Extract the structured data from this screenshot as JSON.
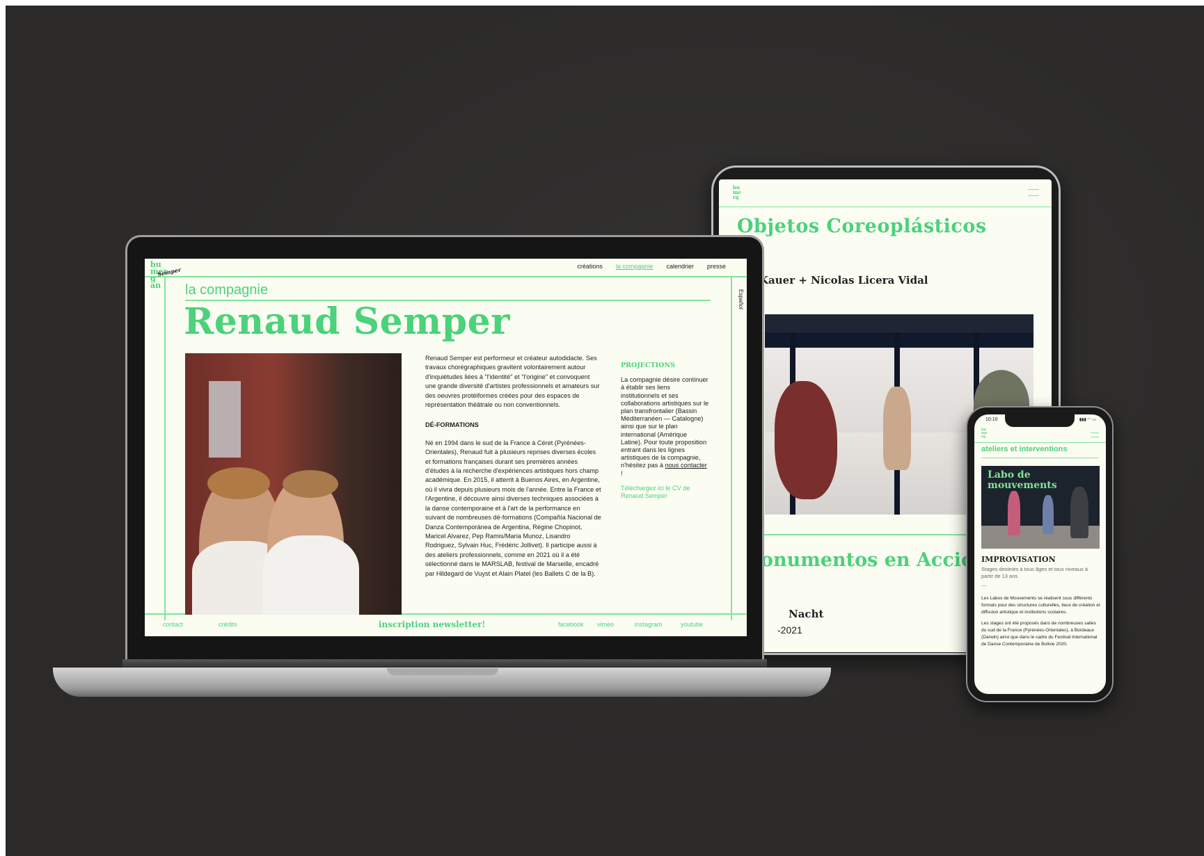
{
  "laptop": {
    "nav": [
      "créations",
      "la compagnie",
      "calendrier",
      "presse"
    ],
    "nav_active_index": 1,
    "section": "la compagnie",
    "lang": "Español",
    "name": "Renaud Semper",
    "intro": "Renaud Semper est performeur et créateur autodidacte. Ses travaux chorégraphiques gravitent volontairement autour d'inquiétudes liées à \"l'identité\" et \"l'origine\" et convoquent une grande diversité d'artistes professionnels et amateurs sur des oeuvres protéiformes créées pour des espaces de représentation théâtrale ou non conventionnels.",
    "bio_heading": "DÉ-FORMATIONS",
    "bio": "Né en 1994 dans le sud de la France à Céret (Pyrénées-Orientales), Renaud fuit à plusieurs reprises diverses écoles et formations françaises durant ses premières années d'études à la recherche d'expériences artistiques hors champ académique. En 2015, il atterrit à Buenos Aires, en Argentine, où il vivra depuis plusieurs mois de l'année. Entre la France et l'Argentine, il découvre ainsi diverses techniques associées à la danse contemporaine et à l'art de la performance en suivant de nombreuses dé-formations (Compañía Nacional de Danza Contemporánea de Argentina, Régine Chopinot, Maricel Alvarez, Pep Ramis/Maria Munoz, Lisandro Rodriguez, Sylvain Huc, Frédéric Jollivet). Il participe aussi à des ateliers professionnels, comme en 2021 où il a été sélectionné dans le MARSLAB, festival de Marseille, encadré par Hildegard de Vuyst et Alain Platel (les Ballets C de la B).",
    "side_heading": "PROJECTIONS",
    "side_text": "La compagnie désire continuer à établir ses liens institutionnels et ses collaborations artistiques sur le plan transfrontalier (Bassin Méditerranéen — Catalogne) ainsi que sur le plan international (Amérique Latine). Pour toute proposition entrant dans les lignes artistiques de la compagnie, n'hésitez pas à",
    "side_link": "nous contacter",
    "side_link_suffix": " !",
    "side_cv": "Téléchargez ici le CV de Renaud Semper",
    "footer": {
      "contact": "contact",
      "credits": "crédits",
      "newsletter": "inscription newsletter!",
      "facebook": "facebook",
      "vimeo": "vimeo",
      "instagram": "instagram",
      "youtube": "youtube"
    },
    "logo_text": "bu\nmer\ng\nan"
  },
  "tablet": {
    "title": "Objetos Coreoplásticos",
    "credit": "Kauer + Nicolas Licera Vidal",
    "title2": "onumentos en Acció",
    "author": "Nacht",
    "year": "-2021"
  },
  "phone": {
    "time": "10:10",
    "status": "▮▮▮ ◠ ▭",
    "section": "ateliers et interventions",
    "card_title": "Labo de mouvements",
    "heading": "IMPROVISATION",
    "sub": "Stages destinés à tous âges et tous niveaux à partir de 13 ans",
    "body1": "Les Labos de Mouvements se réalisent sous différents formats pour des structures culturelles, lieux de création et diffusion artistique et institutions scolaires.",
    "body2": "Les stages ont été proposés dans de nombreuses salles du sud de la France (Pyrénées-Orientales), à Bordeaux (Darwin) ainsi que dans le cadre du Festival International de Danse Contemporaine de Bolivie 2020."
  },
  "colors": {
    "accent": "#4bd27a",
    "page_bg": "#fbfcf2",
    "scene_bg": "#2b2a29"
  }
}
